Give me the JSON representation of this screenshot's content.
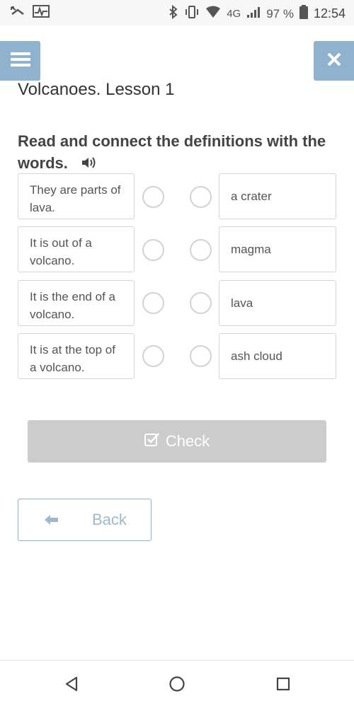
{
  "status_bar": {
    "battery_percent": "97 %",
    "network": "4G",
    "time": "12:54",
    "icons": [
      "missed-call-icon",
      "activity-icon",
      "bluetooth-icon",
      "vibrate-icon",
      "wifi-icon",
      "signal-icon",
      "battery-icon"
    ]
  },
  "header": {
    "menu_icon": "hamburger-menu-icon",
    "close_icon": "close-icon",
    "accent_color": "#8fb3cd"
  },
  "lesson": {
    "title": "Volcanoes. Lesson 1",
    "instruction": "Read and connect the definitions with the words.",
    "audio_icon": "speaker-icon"
  },
  "definitions": [
    {
      "text": "They are parts of lava."
    },
    {
      "text": "It is out of a volcano."
    },
    {
      "text": "It is the end of a volcano."
    },
    {
      "text": "It is at the top of a volcano."
    }
  ],
  "words": [
    {
      "text": "a crater"
    },
    {
      "text": "magma"
    },
    {
      "text": "lava"
    },
    {
      "text": "ash cloud"
    }
  ],
  "actions": {
    "check_label": "Check",
    "check_icon": "checkbox-icon",
    "back_label": "Back",
    "back_icon": "arrow-left-icon"
  },
  "nav_bar": {
    "icons": [
      "back-triangle-icon",
      "home-circle-icon",
      "recents-square-icon"
    ]
  }
}
